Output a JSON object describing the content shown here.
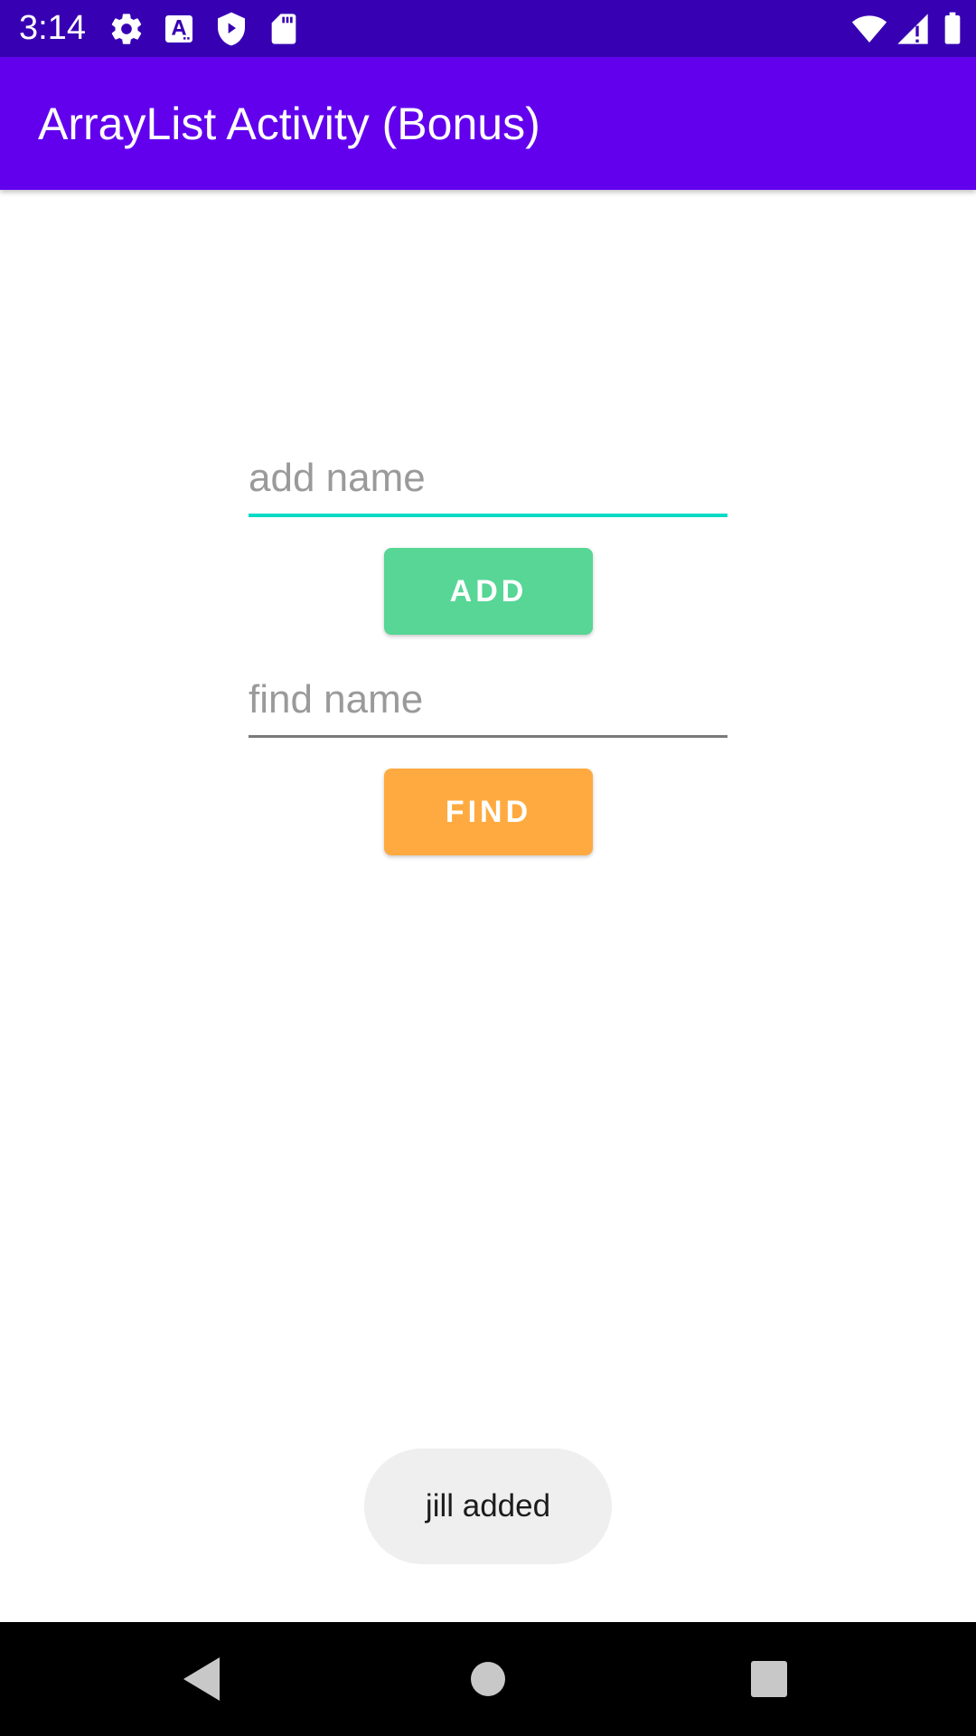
{
  "status_bar": {
    "time": "3:14",
    "icons": [
      "gear-icon",
      "font-a-icon",
      "shield-play-icon",
      "sd-card-icon",
      "wifi-icon",
      "cell-signal-icon",
      "battery-icon"
    ]
  },
  "app_bar": {
    "title": "ArrayList Activity (Bonus)"
  },
  "form": {
    "add_field": {
      "value": "",
      "placeholder": "add name"
    },
    "add_button_label": "ADD",
    "find_field": {
      "value": "",
      "placeholder": "find name"
    },
    "find_button_label": "FIND"
  },
  "toast": {
    "message": "jill added"
  },
  "nav_bar": {
    "icons": [
      "back-icon",
      "home-icon",
      "recents-icon"
    ]
  },
  "colors": {
    "status_bar": "#3700b3",
    "app_bar": "#6200ee",
    "add_field_underline": "#03dac5",
    "add_button": "#57d696",
    "find_button": "#ffaa40",
    "toast_background": "#efefef",
    "nav_bar": "#000000"
  }
}
